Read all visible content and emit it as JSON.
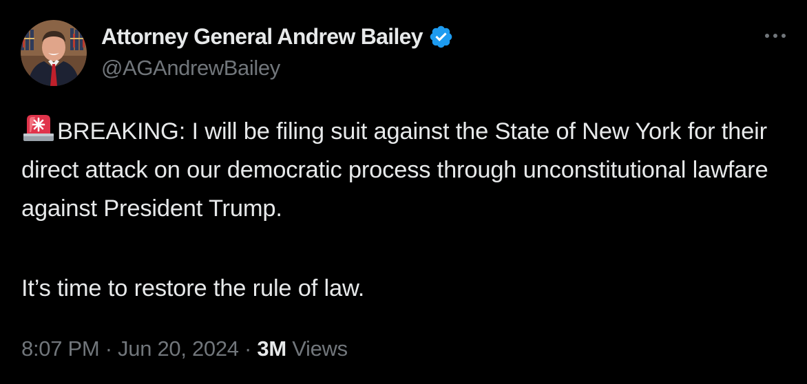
{
  "author": {
    "display_name": "Attorney General Andrew Bailey",
    "handle": "@AGAndrewBailey",
    "verified": true
  },
  "tweet": {
    "alert_icon": "police-car-light-icon",
    "first_paragraph": "BREAKING: I will be filing suit against the State of New York for their direct attack on our democratic process through unconstitutional lawfare against President Trump.",
    "second_paragraph": "It’s time to restore the rule of law."
  },
  "meta": {
    "time": "8:07 PM",
    "separator": "·",
    "date": "Jun 20, 2024",
    "views_count": "3M",
    "views_label": "Views"
  },
  "icons": {
    "more": "more-dots-icon",
    "verified": "verified-badge-icon"
  },
  "colors": {
    "background": "#000000",
    "text_primary": "#e7e9ea",
    "text_secondary": "#71767b",
    "verified_blue": "#1d9bf0",
    "siren_red": "#e0344b"
  }
}
